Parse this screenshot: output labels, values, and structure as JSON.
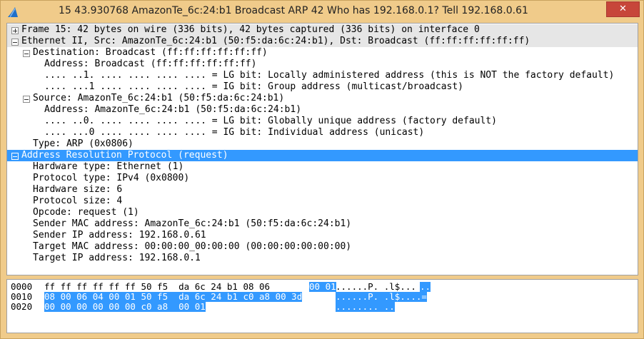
{
  "window": {
    "title": "15 43.930768 AmazonTe_6c:24:b1 Broadcast ARP 42 Who has 192.168.0.1? Tell 192.168.0.61",
    "close_label": "✕"
  },
  "tree": {
    "frame": "Frame 15: 42 bytes on wire (336 bits), 42 bytes captured (336 bits) on interface 0",
    "ethernet": "Ethernet II, Src: AmazonTe_6c:24:b1 (50:f5:da:6c:24:b1), Dst: Broadcast (ff:ff:ff:ff:ff:ff)",
    "dst": "Destination: Broadcast (ff:ff:ff:ff:ff:ff)",
    "dst_address": "Address: Broadcast (ff:ff:ff:ff:ff:ff)",
    "dst_lg": ".... ..1. .... .... .... .... = LG bit: Locally administered address (this is NOT the factory default)",
    "dst_ig": ".... ...1 .... .... .... .... = IG bit: Group address (multicast/broadcast)",
    "src": "Source: AmazonTe_6c:24:b1 (50:f5:da:6c:24:b1)",
    "src_address": "Address: AmazonTe_6c:24:b1 (50:f5:da:6c:24:b1)",
    "src_lg": ".... ..0. .... .... .... .... = LG bit: Globally unique address (factory default)",
    "src_ig": ".... ...0 .... .... .... .... = IG bit: Individual address (unicast)",
    "type": "Type: ARP (0x0806)",
    "arp": "Address Resolution Protocol (request)",
    "hw_type": "Hardware type: Ethernet (1)",
    "proto_type": "Protocol type: IPv4 (0x0800)",
    "hw_size": "Hardware size: 6",
    "proto_size": "Protocol size: 4",
    "opcode": "Opcode: request (1)",
    "sender_mac": "Sender MAC address: AmazonTe_6c:24:b1 (50:f5:da:6c:24:b1)",
    "sender_ip": "Sender IP address: 192.168.0.61",
    "target_mac": "Target MAC address: 00:00:00_00:00:00 (00:00:00:00:00:00)",
    "target_ip": "Target IP address: 192.168.0.1"
  },
  "hex": {
    "rows": [
      {
        "offset": "0000",
        "hex_plain": "ff ff ff ff ff ff 50 f5  da 6c 24 b1 08 06 ",
        "hex_sel": "00 01",
        "ascii_plain": "......P. .l$...",
        "ascii_sel": ".."
      },
      {
        "offset": "0010",
        "hex_plain": "",
        "hex_sel": "08 00 06 04 00 01 50 f5  da 6c 24 b1 c0 a8 00 3d",
        "ascii_plain": "",
        "ascii_sel": "......P. .l$....="
      },
      {
        "offset": "0020",
        "hex_plain": "",
        "hex_sel": "00 00 00 00 00 00 c0 a8  00 01",
        "ascii_plain": "",
        "ascii_sel": "........ .."
      }
    ]
  }
}
